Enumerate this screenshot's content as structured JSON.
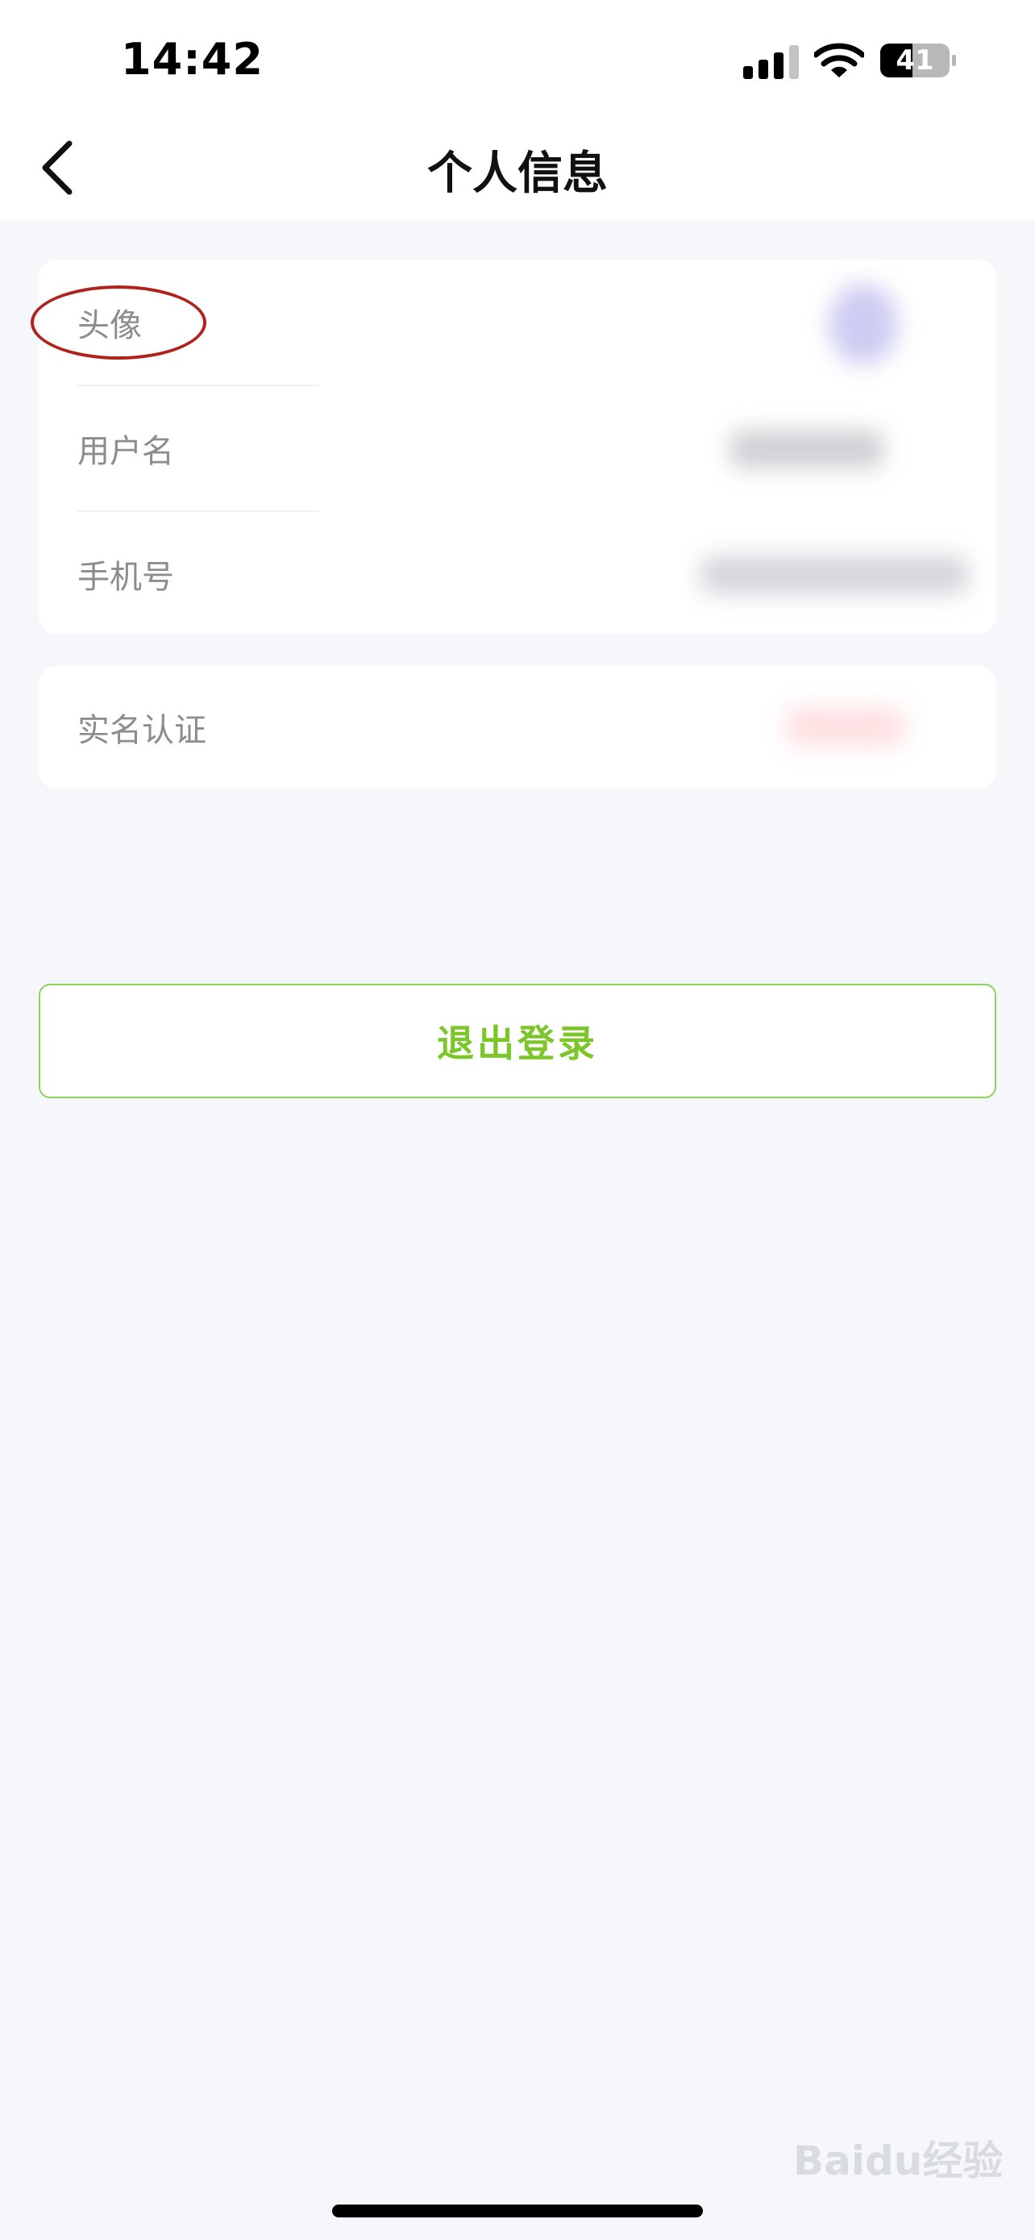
{
  "status_bar": {
    "time": "14:42",
    "battery_level": "41",
    "icons": [
      "cellular-signal-icon",
      "wifi-icon",
      "battery-icon"
    ]
  },
  "nav": {
    "title": "个人信息",
    "back_icon": "chevron-left-icon"
  },
  "profile_card": {
    "rows": [
      {
        "label": "头像"
      },
      {
        "label": "用户名"
      },
      {
        "label": "手机号"
      }
    ]
  },
  "verification_card": {
    "label": "实名认证"
  },
  "logout_button": {
    "label": "退出登录"
  },
  "watermark": {
    "text": "Baidu经验"
  },
  "colors": {
    "accent_green": "#7cc62a",
    "highlight_red": "#b0231c",
    "background": "#f6f7fb"
  }
}
